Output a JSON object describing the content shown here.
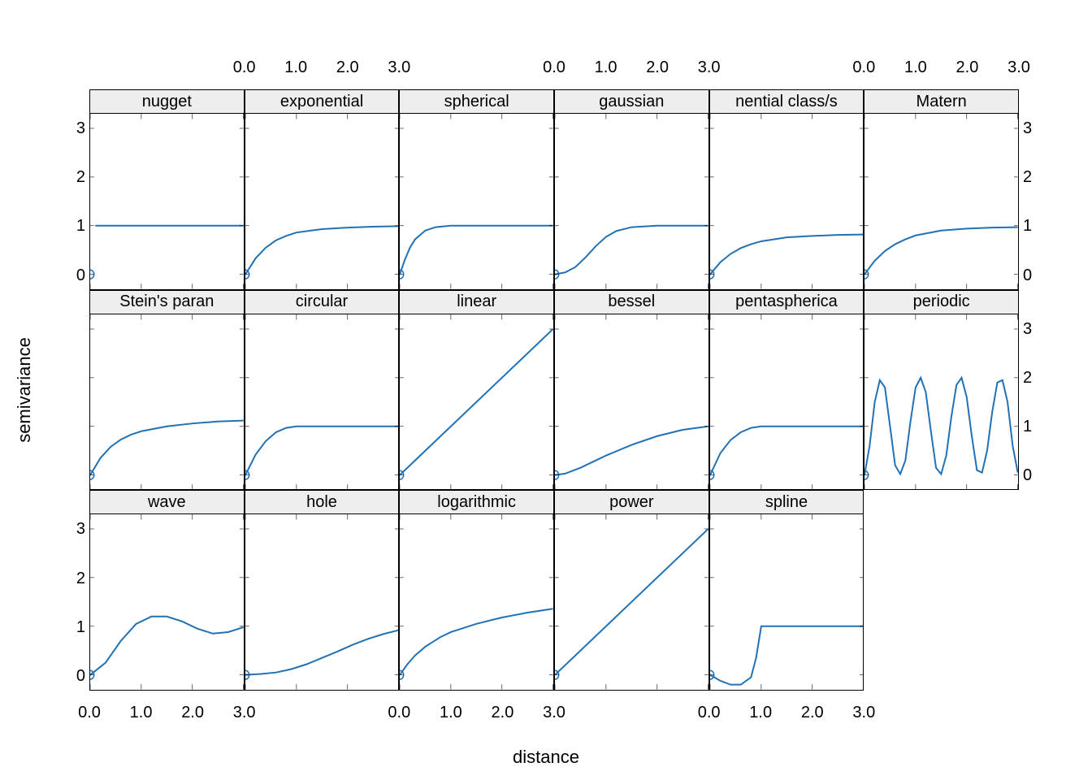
{
  "xlabel": "distance",
  "ylabel": "semivariance",
  "x_ticks": [
    "0.0",
    "1.0",
    "2.0",
    "3.0"
  ],
  "y_ticks": [
    "0",
    "1",
    "2",
    "3"
  ],
  "colors": {
    "line": "#2171b5",
    "strip_bg": "#eeeeee"
  },
  "chart_data": {
    "type": "line",
    "xlim": [
      0,
      3
    ],
    "ylim": [
      -0.3,
      3.3
    ],
    "xlabel": "distance",
    "ylabel": "semivariance",
    "x_ticks": [
      0.0,
      1.0,
      2.0,
      3.0
    ],
    "y_ticks": [
      0,
      1,
      2,
      3
    ],
    "panels": [
      {
        "row": 0,
        "col": 0,
        "title": "nugget",
        "marker_at": [
          0,
          0
        ],
        "points": [
          [
            0.1,
            1.0
          ],
          [
            3.0,
            1.0
          ]
        ]
      },
      {
        "row": 0,
        "col": 1,
        "title": "exponential",
        "marker_at": [
          0,
          0
        ],
        "points": [
          [
            0,
            0
          ],
          [
            0.2,
            0.33
          ],
          [
            0.4,
            0.55
          ],
          [
            0.6,
            0.7
          ],
          [
            0.8,
            0.79
          ],
          [
            1.0,
            0.86
          ],
          [
            1.5,
            0.93
          ],
          [
            2.0,
            0.96
          ],
          [
            2.5,
            0.98
          ],
          [
            3.0,
            0.99
          ]
        ]
      },
      {
        "row": 0,
        "col": 2,
        "title": "spherical",
        "marker_at": [
          0,
          0
        ],
        "points": [
          [
            0,
            0
          ],
          [
            0.1,
            0.3
          ],
          [
            0.2,
            0.55
          ],
          [
            0.3,
            0.72
          ],
          [
            0.5,
            0.9
          ],
          [
            0.7,
            0.97
          ],
          [
            1.0,
            1.0
          ],
          [
            3.0,
            1.0
          ]
        ]
      },
      {
        "row": 0,
        "col": 3,
        "title": "gaussian",
        "marker_at": [
          0,
          0
        ],
        "points": [
          [
            0,
            0
          ],
          [
            0.2,
            0.04
          ],
          [
            0.4,
            0.15
          ],
          [
            0.6,
            0.35
          ],
          [
            0.8,
            0.58
          ],
          [
            1.0,
            0.77
          ],
          [
            1.2,
            0.89
          ],
          [
            1.5,
            0.97
          ],
          [
            2.0,
            1.0
          ],
          [
            3.0,
            1.0
          ]
        ]
      },
      {
        "row": 0,
        "col": 4,
        "title": "nential class/s",
        "marker_at": [
          0,
          0
        ],
        "points": [
          [
            0,
            0
          ],
          [
            0.2,
            0.25
          ],
          [
            0.4,
            0.42
          ],
          [
            0.6,
            0.54
          ],
          [
            0.8,
            0.62
          ],
          [
            1.0,
            0.68
          ],
          [
            1.5,
            0.76
          ],
          [
            2.0,
            0.79
          ],
          [
            2.5,
            0.81
          ],
          [
            3.0,
            0.82
          ]
        ]
      },
      {
        "row": 0,
        "col": 5,
        "title": "Matern",
        "marker_at": [
          0,
          0
        ],
        "points": [
          [
            0,
            0
          ],
          [
            0.2,
            0.28
          ],
          [
            0.4,
            0.48
          ],
          [
            0.6,
            0.62
          ],
          [
            0.8,
            0.72
          ],
          [
            1.0,
            0.8
          ],
          [
            1.5,
            0.9
          ],
          [
            2.0,
            0.94
          ],
          [
            2.5,
            0.96
          ],
          [
            3.0,
            0.97
          ]
        ]
      },
      {
        "row": 1,
        "col": 0,
        "title": "Stein's paran",
        "marker_at": [
          0,
          0
        ],
        "points": [
          [
            0,
            0
          ],
          [
            0.2,
            0.35
          ],
          [
            0.4,
            0.58
          ],
          [
            0.6,
            0.73
          ],
          [
            0.8,
            0.83
          ],
          [
            1.0,
            0.9
          ],
          [
            1.5,
            1.0
          ],
          [
            2.0,
            1.06
          ],
          [
            2.5,
            1.1
          ],
          [
            3.0,
            1.12
          ]
        ]
      },
      {
        "row": 1,
        "col": 1,
        "title": "circular",
        "marker_at": [
          0,
          0
        ],
        "points": [
          [
            0,
            0
          ],
          [
            0.2,
            0.42
          ],
          [
            0.4,
            0.7
          ],
          [
            0.6,
            0.88
          ],
          [
            0.8,
            0.97
          ],
          [
            1.0,
            1.0
          ],
          [
            3.0,
            1.0
          ]
        ]
      },
      {
        "row": 1,
        "col": 2,
        "title": "linear",
        "marker_at": [
          0,
          0
        ],
        "points": [
          [
            0,
            0
          ],
          [
            3.0,
            3.0
          ]
        ]
      },
      {
        "row": 1,
        "col": 3,
        "title": "bessel",
        "marker_at": [
          0,
          0
        ],
        "points": [
          [
            0,
            0
          ],
          [
            0.2,
            0.03
          ],
          [
            0.5,
            0.15
          ],
          [
            1.0,
            0.4
          ],
          [
            1.5,
            0.62
          ],
          [
            2.0,
            0.8
          ],
          [
            2.5,
            0.93
          ],
          [
            3.0,
            1.0
          ]
        ]
      },
      {
        "row": 1,
        "col": 4,
        "title": "pentaspherica",
        "marker_at": [
          0,
          0
        ],
        "points": [
          [
            0,
            0
          ],
          [
            0.2,
            0.45
          ],
          [
            0.4,
            0.72
          ],
          [
            0.6,
            0.88
          ],
          [
            0.8,
            0.97
          ],
          [
            1.0,
            1.0
          ],
          [
            3.0,
            1.0
          ]
        ]
      },
      {
        "row": 1,
        "col": 5,
        "title": "periodic",
        "marker_at": [
          0,
          0
        ],
        "points": [
          [
            0,
            0
          ],
          [
            0.1,
            0.6
          ],
          [
            0.2,
            1.5
          ],
          [
            0.3,
            1.95
          ],
          [
            0.4,
            1.8
          ],
          [
            0.5,
            1.0
          ],
          [
            0.6,
            0.2
          ],
          [
            0.7,
            0.02
          ],
          [
            0.8,
            0.3
          ],
          [
            0.9,
            1.1
          ],
          [
            1.0,
            1.8
          ],
          [
            1.1,
            2.0
          ],
          [
            1.2,
            1.7
          ],
          [
            1.3,
            0.9
          ],
          [
            1.4,
            0.15
          ],
          [
            1.5,
            0.02
          ],
          [
            1.6,
            0.4
          ],
          [
            1.7,
            1.2
          ],
          [
            1.8,
            1.85
          ],
          [
            1.9,
            2.0
          ],
          [
            2.0,
            1.6
          ],
          [
            2.1,
            0.8
          ],
          [
            2.2,
            0.1
          ],
          [
            2.3,
            0.05
          ],
          [
            2.4,
            0.5
          ],
          [
            2.5,
            1.3
          ],
          [
            2.6,
            1.9
          ],
          [
            2.7,
            1.95
          ],
          [
            2.8,
            1.5
          ],
          [
            2.9,
            0.6
          ],
          [
            3.0,
            0.05
          ]
        ]
      },
      {
        "row": 2,
        "col": 0,
        "title": "wave",
        "marker_at": [
          0,
          0
        ],
        "points": [
          [
            0,
            0
          ],
          [
            0.3,
            0.25
          ],
          [
            0.6,
            0.7
          ],
          [
            0.9,
            1.05
          ],
          [
            1.2,
            1.2
          ],
          [
            1.5,
            1.2
          ],
          [
            1.8,
            1.1
          ],
          [
            2.1,
            0.95
          ],
          [
            2.4,
            0.85
          ],
          [
            2.7,
            0.88
          ],
          [
            3.0,
            0.98
          ]
        ]
      },
      {
        "row": 2,
        "col": 1,
        "title": "hole",
        "marker_at": [
          0,
          0
        ],
        "points": [
          [
            0,
            0
          ],
          [
            0.3,
            0.02
          ],
          [
            0.6,
            0.05
          ],
          [
            0.9,
            0.12
          ],
          [
            1.2,
            0.22
          ],
          [
            1.5,
            0.35
          ],
          [
            1.8,
            0.48
          ],
          [
            2.1,
            0.62
          ],
          [
            2.4,
            0.74
          ],
          [
            2.7,
            0.84
          ],
          [
            3.0,
            0.92
          ]
        ]
      },
      {
        "row": 2,
        "col": 2,
        "title": "logarithmic",
        "marker_at": [
          0,
          0
        ],
        "points": [
          [
            0,
            0
          ],
          [
            0.15,
            0.22
          ],
          [
            0.3,
            0.4
          ],
          [
            0.5,
            0.58
          ],
          [
            0.8,
            0.78
          ],
          [
            1.0,
            0.88
          ],
          [
            1.5,
            1.05
          ],
          [
            2.0,
            1.18
          ],
          [
            2.5,
            1.28
          ],
          [
            3.0,
            1.36
          ]
        ]
      },
      {
        "row": 2,
        "col": 3,
        "title": "power",
        "marker_at": [
          0,
          0
        ],
        "points": [
          [
            0,
            0
          ],
          [
            3.0,
            3.0
          ]
        ]
      },
      {
        "row": 2,
        "col": 4,
        "title": "spline",
        "marker_at": [
          0,
          0
        ],
        "points": [
          [
            0,
            0
          ],
          [
            0.2,
            -0.12
          ],
          [
            0.4,
            -0.2
          ],
          [
            0.6,
            -0.2
          ],
          [
            0.8,
            -0.05
          ],
          [
            0.9,
            0.35
          ],
          [
            1.0,
            1.0
          ],
          [
            3.0,
            1.0
          ]
        ]
      }
    ]
  }
}
